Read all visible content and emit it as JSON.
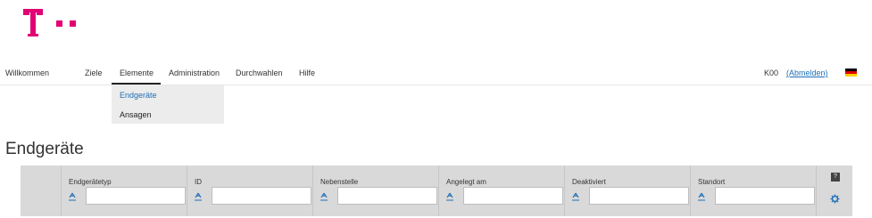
{
  "nav": {
    "items": [
      {
        "label": "Willkommen"
      },
      {
        "label": "Ziele"
      },
      {
        "label": "Elemente"
      },
      {
        "label": "Administration"
      },
      {
        "label": "Durchwahlen"
      },
      {
        "label": "Hilfe"
      }
    ],
    "active_index": 2
  },
  "user": {
    "code": "K00",
    "logout_label": "(Abmelden)"
  },
  "dropdown": {
    "items": [
      {
        "label": "Endgeräte",
        "active": true
      },
      {
        "label": "Ansagen",
        "active": false
      }
    ]
  },
  "page": {
    "title": "Endgeräte"
  },
  "grid": {
    "columns": [
      {
        "label": "Endgerätetyp",
        "filter_value": ""
      },
      {
        "label": "ID",
        "filter_value": ""
      },
      {
        "label": "Nebenstelle",
        "filter_value": ""
      },
      {
        "label": "Angelegt am",
        "filter_value": ""
      },
      {
        "label": "Deaktiviert",
        "filter_value": ""
      },
      {
        "label": "Standort",
        "filter_value": ""
      }
    ],
    "help_label": "?"
  },
  "colors": {
    "brand_magenta": "#e20074",
    "link_blue": "#1e6fb8",
    "header_gray": "#d9d9d9",
    "dropdown_gray": "#ececec"
  },
  "icons": {
    "logo": "telekom-t-logo",
    "sort": "sort-icon",
    "settings": "gear-icon",
    "help": "help-icon",
    "language": "german-flag-icon"
  }
}
